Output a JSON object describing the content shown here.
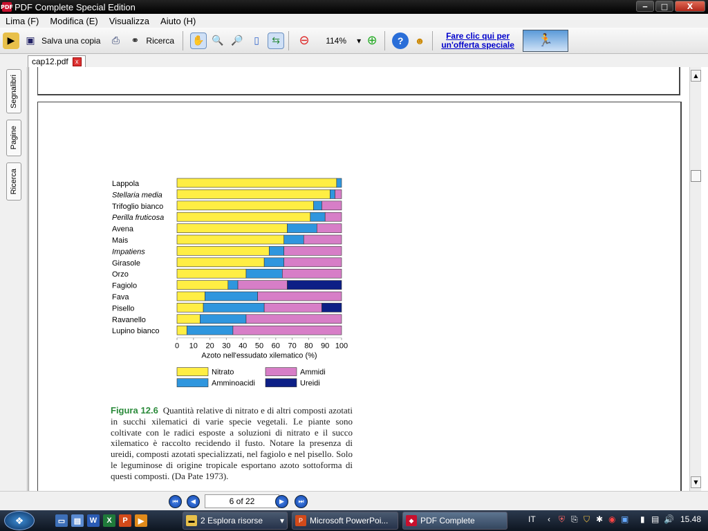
{
  "window": {
    "title": "PDF Complete Special Edition",
    "app_icon_text": "PDF",
    "controls": {
      "minimize": "‒",
      "maximize": "□",
      "close": "X"
    }
  },
  "menu": [
    "Lima (F)",
    "Modifica (E)",
    "Visualizza",
    "Aiuto (H)"
  ],
  "toolbar": {
    "save_copy_label": "Salva una copia",
    "search_label": "Ricerca",
    "zoom_value": "114%",
    "promo_line1": "Fare clic qui per",
    "promo_line2": "un'offerta speciale"
  },
  "tab": {
    "label": "cap12.pdf",
    "close": "x"
  },
  "side_tabs": [
    "Segnalibri",
    "Pagine",
    "Ricerca"
  ],
  "nav": {
    "page_indicator": "6 of 22"
  },
  "chart_data": {
    "type": "bar",
    "orientation": "horizontal",
    "stacked": true,
    "categories": [
      "Lappola",
      "Stellaria media",
      "Trifoglio bianco",
      "Perilla fruticosa",
      "Avena",
      "Mais",
      "Impatiens",
      "Girasole",
      "Orzo",
      "Fagiolo",
      "Fava",
      "Pisello",
      "Ravanello",
      "Lupino bianco"
    ],
    "italic_categories": [
      "Stellaria media",
      "Perilla fruticosa",
      "Impatiens"
    ],
    "series": [
      {
        "name": "Nitrato",
        "color": "#ffee44",
        "values": [
          97,
          93,
          83,
          81,
          67,
          65,
          56,
          53,
          42,
          31,
          17,
          16,
          14,
          6
        ]
      },
      {
        "name": "Amminoacidi",
        "color": "#2f96de",
        "values": [
          3,
          3,
          5,
          9,
          18,
          12,
          9,
          12,
          22,
          6,
          32,
          37,
          28,
          28
        ]
      },
      {
        "name": "Ammidi",
        "color": "#d77ec7",
        "values": [
          0,
          4,
          12,
          10,
          15,
          23,
          35,
          35,
          36,
          30,
          51,
          35,
          58,
          66
        ]
      },
      {
        "name": "Ureidi",
        "color": "#0d1f86",
        "values": [
          0,
          0,
          0,
          0,
          0,
          0,
          0,
          0,
          0,
          33,
          0,
          12,
          0,
          0
        ]
      }
    ],
    "xlabel": "Azoto nell'essudato xilematico (%)",
    "xlim": [
      0,
      100
    ],
    "xticks": [
      0,
      10,
      20,
      30,
      40,
      50,
      60,
      70,
      80,
      90,
      100
    ],
    "legend_placement": "bottom",
    "grid": false
  },
  "caption": {
    "figure_label": "Figura 12.6",
    "text": "Quantità relative di nitrato e di altri composti azotati in succhi xilematici di varie specie vegetali. Le piante sono coltivate con le radici esposte a soluzioni di nitrato e il succo xilematico è raccolto recidendo il fusto. Notare la presenza di ureidi, composti azotati specializzati, nel fagiolo e nel pisello. Solo le leguminose di origine tropicale esportano azoto sottoforma di questi composti. (Da Pate 1973)."
  },
  "taskbar": {
    "tasks": [
      "2 Esplora risorse",
      "Microsoft PowerPoi...",
      "PDF Complete"
    ],
    "language": "IT",
    "clock": "15.48"
  }
}
